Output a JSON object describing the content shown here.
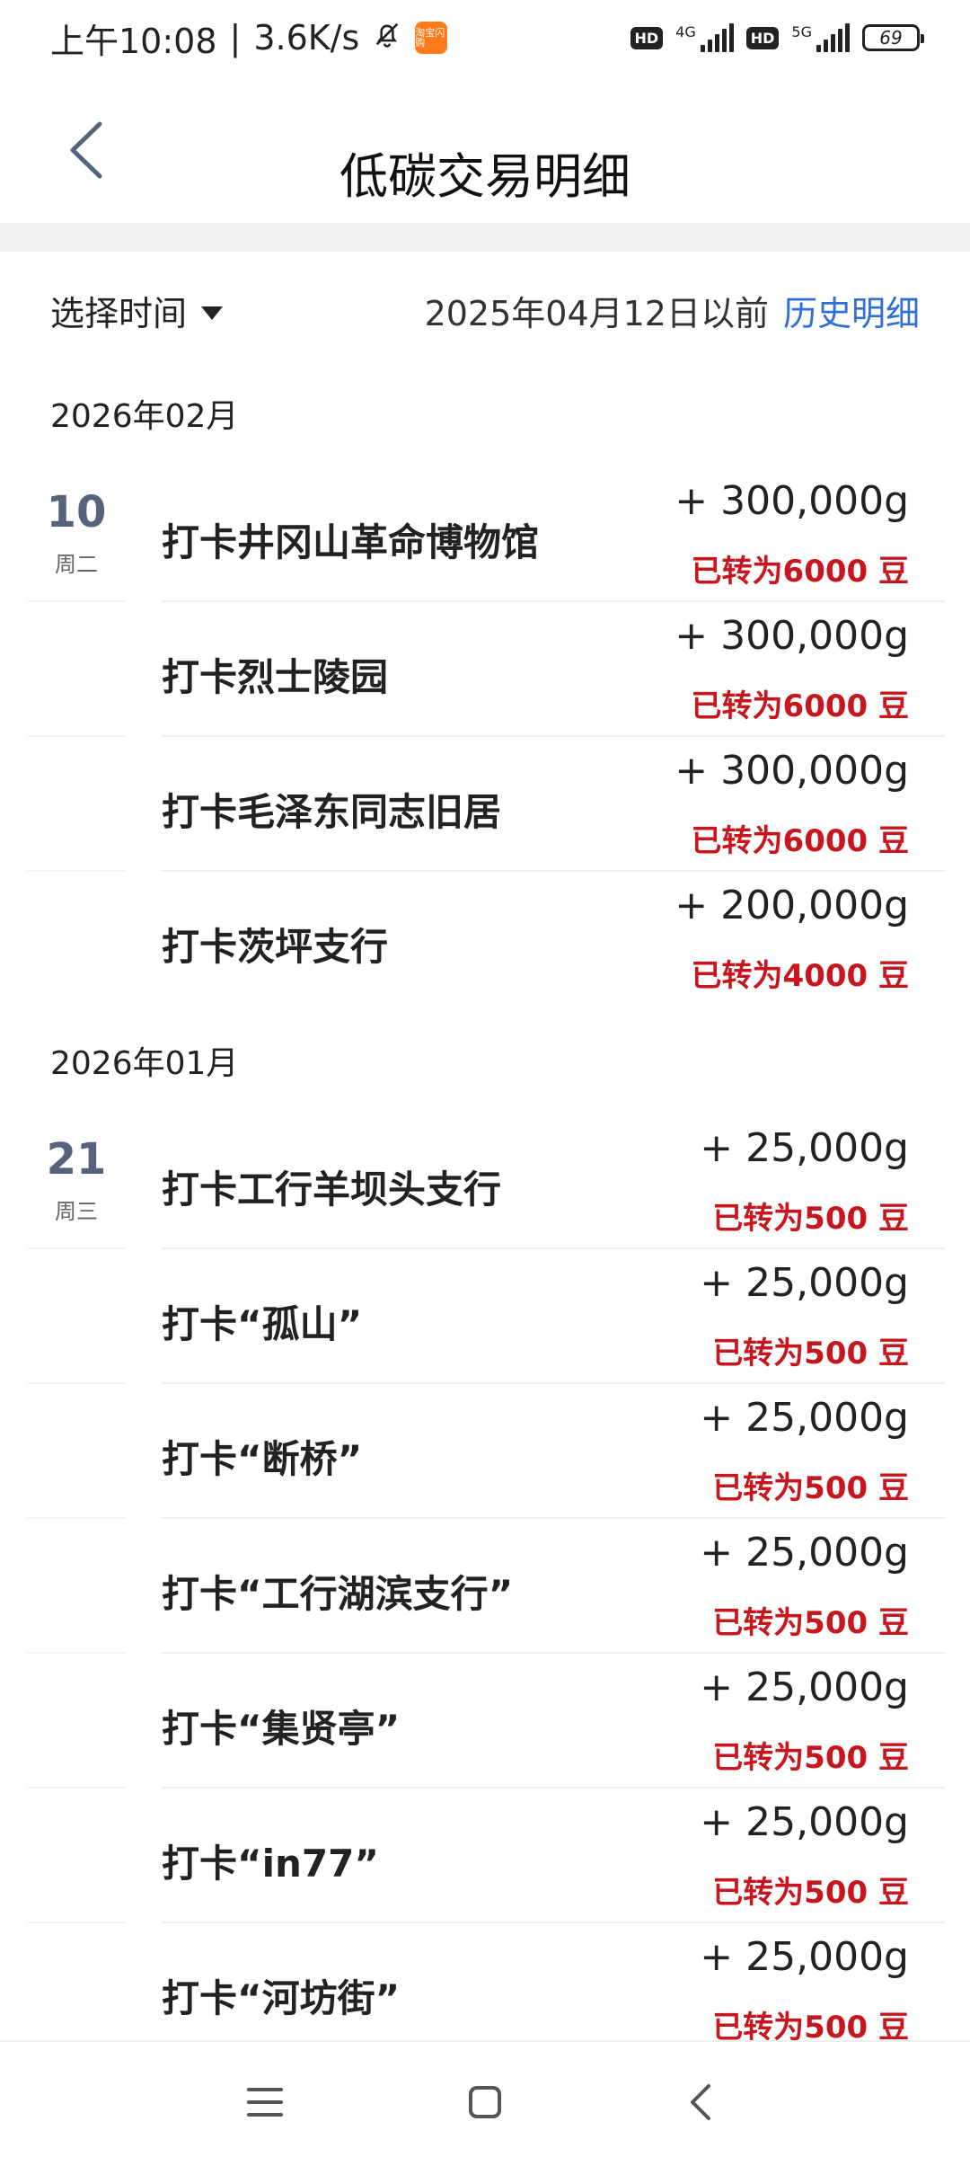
{
  "status_bar": {
    "time": "上午10:08",
    "net_speed": "3.6K/s",
    "app_badge": "淘宝闪购",
    "hd1": "HD",
    "net1": "4G",
    "hd2": "HD",
    "net2": "5G",
    "battery": "69"
  },
  "header": {
    "title": "低碳交易明细"
  },
  "filter": {
    "select_label": "选择时间",
    "before_text": "2025年04月12日以前",
    "history_link": "历史明细"
  },
  "months": [
    {
      "label": "2026年02月",
      "days": [
        {
          "day": "10",
          "weekday": "周二",
          "entries": [
            {
              "title": "打卡井冈山革命博物馆",
              "amount": "+ 300,000g",
              "beans": "已转为6000 豆"
            },
            {
              "title": "打卡烈士陵园",
              "amount": "+ 300,000g",
              "beans": "已转为6000 豆"
            },
            {
              "title": "打卡毛泽东同志旧居",
              "amount": "+ 300,000g",
              "beans": "已转为6000 豆"
            },
            {
              "title": "打卡茨坪支行",
              "amount": "+ 200,000g",
              "beans": "已转为4000 豆"
            }
          ]
        }
      ]
    },
    {
      "label": "2026年01月",
      "days": [
        {
          "day": "21",
          "weekday": "周三",
          "entries": [
            {
              "title": "打卡工行羊坝头支行",
              "amount": "+ 25,000g",
              "beans": "已转为500 豆"
            },
            {
              "title": "打卡“孤山”",
              "amount": "+ 25,000g",
              "beans": "已转为500 豆"
            },
            {
              "title": "打卡“断桥”",
              "amount": "+ 25,000g",
              "beans": "已转为500 豆"
            },
            {
              "title": "打卡“工行湖滨支行”",
              "amount": "+ 25,000g",
              "beans": "已转为500 豆"
            },
            {
              "title": "打卡“集贤亭”",
              "amount": "+ 25,000g",
              "beans": "已转为500 豆"
            },
            {
              "title": "打卡“in77”",
              "amount": "+ 25,000g",
              "beans": "已转为500 豆"
            },
            {
              "title": "打卡“河坊街”",
              "amount": "+ 25,000g",
              "beans": "已转为500 豆"
            }
          ]
        }
      ]
    }
  ],
  "icons": {
    "back": "chevron-left-icon",
    "dropdown": "triangle-down-icon",
    "nav_menu": "menu-icon",
    "nav_home": "square-icon",
    "nav_back": "chevron-left-icon"
  },
  "colors": {
    "link": "#2f6fd6",
    "beans": "#c8161e",
    "day": "#55637c"
  }
}
